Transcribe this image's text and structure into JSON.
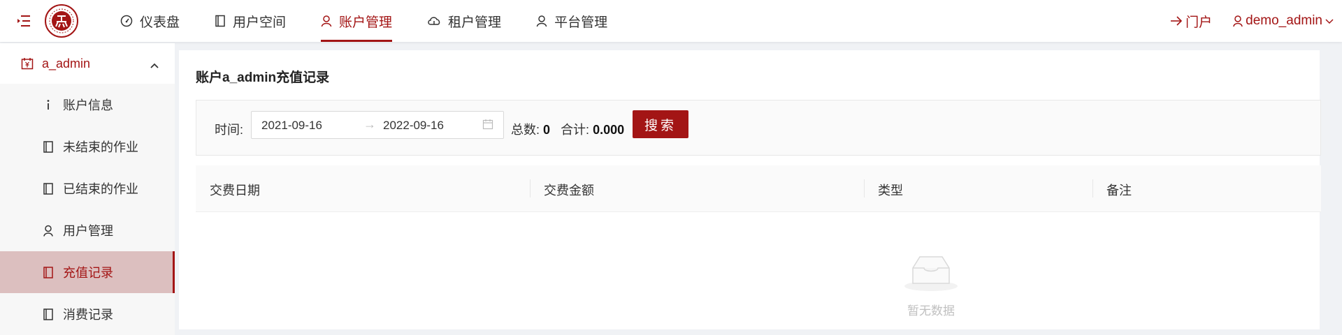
{
  "header": {
    "nav": [
      {
        "label": "仪表盘",
        "icon": "dashboard-icon"
      },
      {
        "label": "用户空间",
        "icon": "book-icon"
      },
      {
        "label": "账户管理",
        "icon": "user-icon",
        "active": true
      },
      {
        "label": "租户管理",
        "icon": "cloud-icon"
      },
      {
        "label": "平台管理",
        "icon": "user-icon"
      }
    ],
    "portal_label": "门户",
    "user_label": "demo_admin"
  },
  "sidebar": {
    "group_label": "a_admin",
    "items": [
      {
        "label": "账户信息",
        "icon": "info-icon"
      },
      {
        "label": "未结束的作业",
        "icon": "book-icon"
      },
      {
        "label": "已结束的作业",
        "icon": "book-icon"
      },
      {
        "label": "用户管理",
        "icon": "user-icon"
      },
      {
        "label": "充值记录",
        "icon": "book-icon",
        "active": true
      },
      {
        "label": "消费记录",
        "icon": "book-icon"
      }
    ]
  },
  "main": {
    "title": "账户a_admin充值记录",
    "filter": {
      "time_label": "时间:",
      "start_date": "2021-09-16",
      "arrow": "→",
      "end_date": "2022-09-16",
      "total_label": "总数:",
      "total_value": "0",
      "sum_label": "合计:",
      "sum_value": "0.000",
      "search_label": "搜索"
    },
    "table": {
      "columns": [
        "交费日期",
        "交费金额",
        "类型",
        "备注"
      ],
      "rows": [],
      "empty_text": "暂无数据"
    }
  },
  "colors": {
    "accent": "#a31515",
    "active_bg": "#dcbfbf"
  }
}
